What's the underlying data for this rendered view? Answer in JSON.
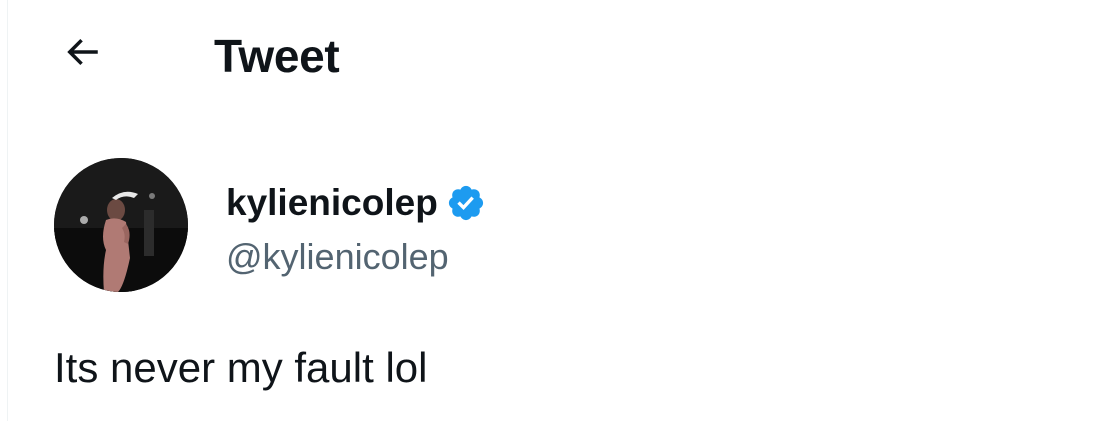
{
  "header": {
    "back_icon": "arrow-left-icon",
    "title": "Tweet"
  },
  "author": {
    "display_name": "kylienicolep",
    "verified": true,
    "verified_icon": "verified-badge-icon",
    "verified_color": "#1d9bf0",
    "handle": "@kylienicolep"
  },
  "tweet": {
    "text": "Its never my fault lol"
  },
  "colors": {
    "text_primary": "#0f1419",
    "text_secondary": "#536471",
    "background": "#ffffff",
    "divider": "#eff3f4"
  }
}
